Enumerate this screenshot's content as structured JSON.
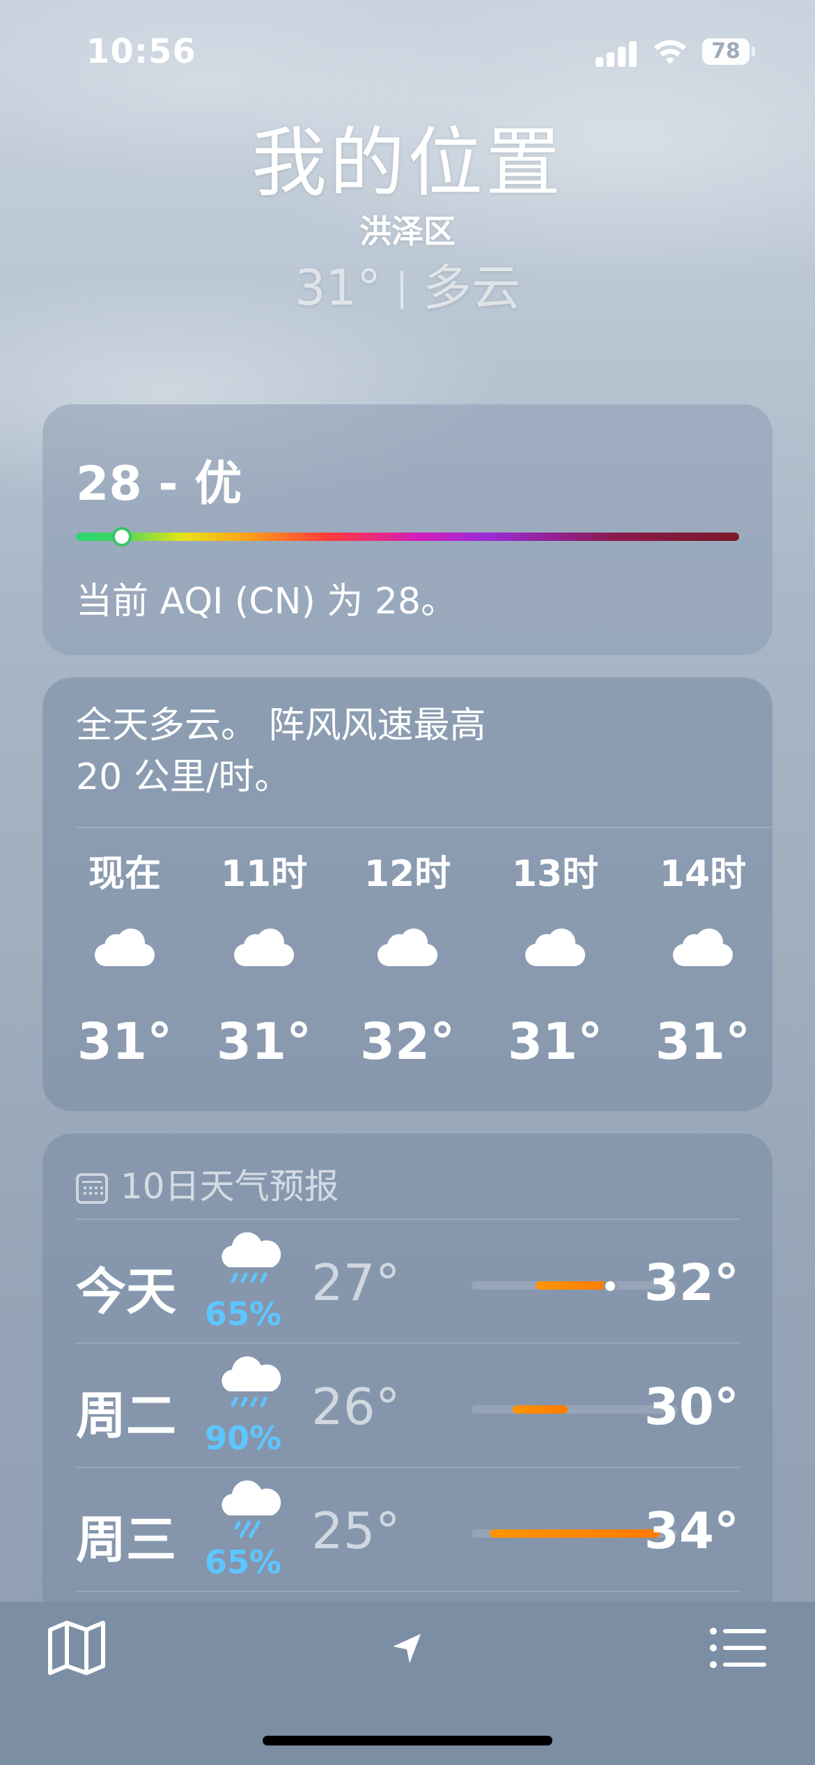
{
  "status_bar": {
    "time": "10:56",
    "battery": "78"
  },
  "header": {
    "title": "我的位置",
    "district": "洪泽区",
    "temp": "31°",
    "condition": "多云"
  },
  "aqi": {
    "title": "28 - 优",
    "description": "当前 AQI (CN) 为 28。",
    "value": 28
  },
  "hourly": {
    "summary_line1": "全天多云。 阵风风速最高",
    "summary_line2": " 20 公里/时。",
    "items": [
      {
        "label": "现在",
        "icon": "cloud-icon",
        "temp": "31°"
      },
      {
        "label": "11时",
        "icon": "cloud-icon",
        "temp": "31°"
      },
      {
        "label": "12时",
        "icon": "cloud-icon",
        "temp": "32°"
      },
      {
        "label": "13时",
        "icon": "cloud-icon",
        "temp": "31°"
      },
      {
        "label": "14时",
        "icon": "cloud-icon",
        "temp": "31°"
      }
    ]
  },
  "daily": {
    "heading": "10日天气预报",
    "range_min": 25,
    "range_max": 34,
    "days": [
      {
        "name": "今天",
        "icon": "cloud-rain-icon",
        "precip": "65%",
        "low": "27°",
        "high": "32°",
        "low_val": 27,
        "high_val": 32,
        "current": 31
      },
      {
        "name": "周二",
        "icon": "cloud-rain-icon",
        "precip": "90%",
        "low": "26°",
        "high": "30°",
        "low_val": 26,
        "high_val": 30
      },
      {
        "name": "周三",
        "icon": "cloud-rain-icon",
        "precip": "65%",
        "low": "25°",
        "high": "34°",
        "low_val": 25,
        "high_val": 34
      }
    ]
  },
  "tabbar": {
    "items": [
      "map-icon",
      "location-arrow-icon",
      "list-icon"
    ]
  },
  "colors": {
    "precip": "#5ec6ff",
    "temp_bar": "#ff9500",
    "aqi_good": "#2ed573"
  }
}
